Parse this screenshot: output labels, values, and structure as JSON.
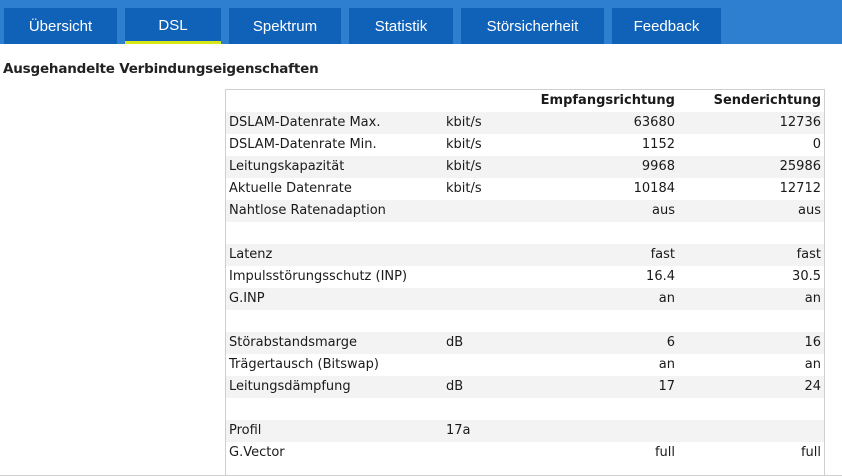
{
  "tabs": [
    {
      "label": "Übersicht",
      "active": false
    },
    {
      "label": "DSL",
      "active": true
    },
    {
      "label": "Spektrum",
      "active": false
    },
    {
      "label": "Statistik",
      "active": false
    },
    {
      "label": "Störsicherheit",
      "active": false
    },
    {
      "label": "Feedback",
      "active": false
    }
  ],
  "section_title": "Ausgehandelte Verbindungseigenschaften",
  "table": {
    "header": {
      "label": "",
      "unit": "",
      "recv": "Empfangsrichtung",
      "send": "Senderichtung"
    },
    "rows": [
      {
        "label": "DSLAM-Datenrate Max.",
        "unit": "kbit/s",
        "recv": "63680",
        "send": "12736"
      },
      {
        "label": "DSLAM-Datenrate Min.",
        "unit": "kbit/s",
        "recv": "1152",
        "send": "0"
      },
      {
        "label": "Leitungskapazität",
        "unit": "kbit/s",
        "recv": "9968",
        "send": "25986"
      },
      {
        "label": "Aktuelle Datenrate",
        "unit": "kbit/s",
        "recv": "10184",
        "send": "12712"
      },
      {
        "label": "Nahtlose Ratenadaption",
        "unit": "",
        "recv": "aus",
        "send": "aus"
      },
      {
        "label": "",
        "unit": "",
        "recv": "",
        "send": ""
      },
      {
        "label": "Latenz",
        "unit": "",
        "recv": "fast",
        "send": "fast"
      },
      {
        "label": "Impulsstörungsschutz (INP)",
        "unit": "",
        "recv": "16.4",
        "send": "30.5"
      },
      {
        "label": "G.INP",
        "unit": "",
        "recv": "an",
        "send": "an"
      },
      {
        "label": "",
        "unit": "",
        "recv": "",
        "send": ""
      },
      {
        "label": "Störabstandsmarge",
        "unit": "dB",
        "recv": "6",
        "send": "16"
      },
      {
        "label": "Trägertausch (Bitswap)",
        "unit": "",
        "recv": "an",
        "send": "an"
      },
      {
        "label": "Leitungsdämpfung",
        "unit": "dB",
        "recv": "17",
        "send": "24"
      },
      {
        "label": "",
        "unit": "",
        "recv": "",
        "send": ""
      },
      {
        "label": "Profil",
        "unit": "17a",
        "recv": "",
        "send": ""
      },
      {
        "label": "G.Vector",
        "unit": "",
        "recv": "full",
        "send": "full"
      }
    ]
  }
}
